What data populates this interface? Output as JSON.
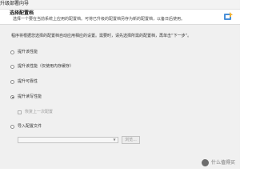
{
  "window": {
    "title": "升级部署向导",
    "header_title": "选择配置档",
    "header_description": "选择一个要在当前系统上应用的配置档。可将已升级的配置档另存为新的配置档，以备日后使用。",
    "header_icon": "wizard-icon"
  },
  "body": {
    "intro": "程序将根据您选择的配置档自动应用相应的设置。需要时，请先选择所需的配置档，再单击“下一步”。",
    "options": [
      {
        "label": "提升该性能",
        "checked": false
      },
      {
        "label": "提升该性能（仅使用内存缓存）",
        "checked": false
      },
      {
        "label": "提升可靠性",
        "checked": false
      },
      {
        "label": "提升读写性能",
        "checked": true
      },
      {
        "label": "导入配置文件",
        "checked": false
      }
    ],
    "checkbox": {
      "label": "恢复上一次配置",
      "checked": false,
      "disabled": true
    },
    "file_select": {
      "value": "",
      "disabled": true
    },
    "browse_button": {
      "label": "浏览...",
      "disabled": true
    }
  },
  "watermark": {
    "text": "什么值得买",
    "icon": "watermark-logo-icon"
  },
  "colors": {
    "body_background": "#f0f0f0",
    "header_background": "#ffffff",
    "disabled_text": "#9a9a9a"
  }
}
